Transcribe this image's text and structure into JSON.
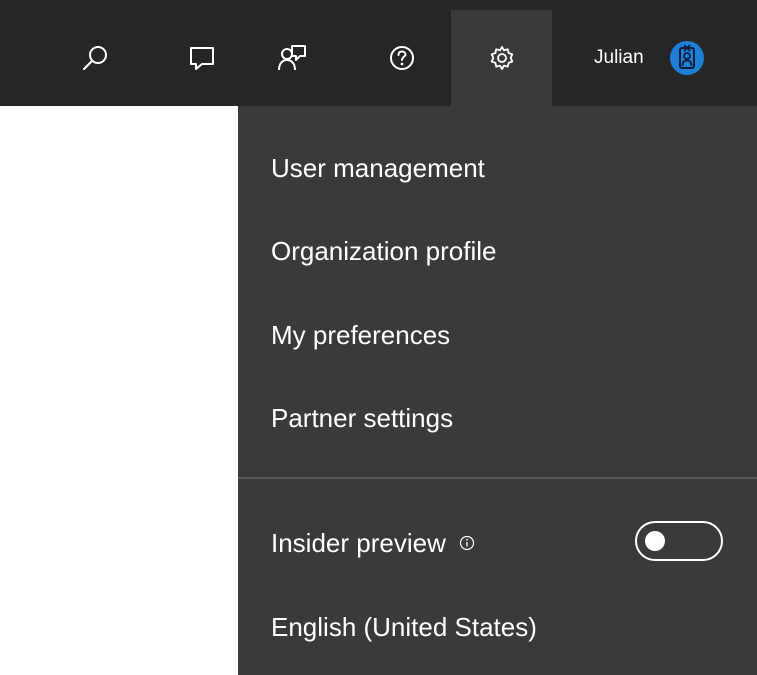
{
  "topbar": {
    "background": "#262626",
    "icons": [
      {
        "name": "search-icon"
      },
      {
        "name": "chat-icon"
      },
      {
        "name": "feedback-icon"
      },
      {
        "name": "help-icon"
      },
      {
        "name": "settings-icon",
        "active": true
      }
    ],
    "user": {
      "name": "Julian",
      "avatar_icon": "badge-person-icon",
      "avatar_color": "#1e7fd6"
    }
  },
  "settings_menu": {
    "background": "#3a3a3a",
    "items": [
      {
        "label": "User management"
      },
      {
        "label": "Organization profile"
      },
      {
        "label": "My preferences"
      },
      {
        "label": "Partner settings"
      }
    ],
    "insider_preview": {
      "label": "Insider preview",
      "info_icon": "info-icon",
      "enabled": false
    },
    "language": "English (United States)"
  }
}
